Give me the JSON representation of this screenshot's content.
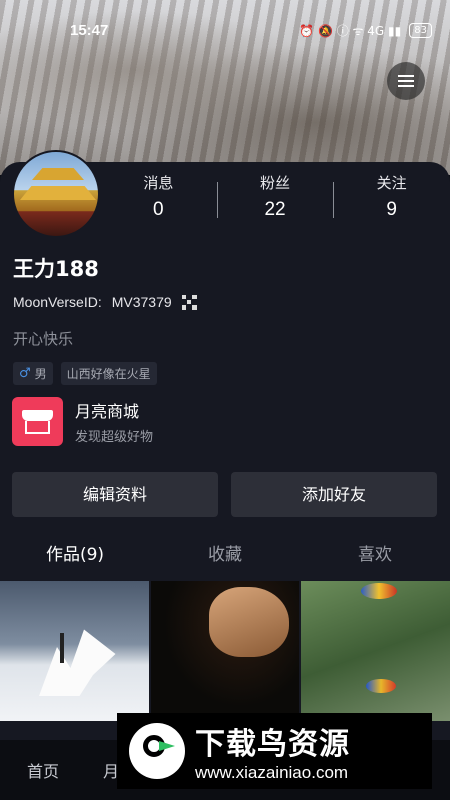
{
  "statusbar": {
    "time": "15:47",
    "indicators": "⏰ 🔕 ⓘ ᯤ 4G ▮▮",
    "battery": "83"
  },
  "profile": {
    "stats": [
      {
        "label": "消息",
        "value": "0"
      },
      {
        "label": "粉丝",
        "value": "22"
      },
      {
        "label": "关注",
        "value": "9"
      }
    ],
    "name": "王力188",
    "id_label": "MoonVerseID:",
    "id_value": "MV37379",
    "bio": "开心快乐",
    "gender_symbol": "♂",
    "gender": "男",
    "location": "山西好像在火星"
  },
  "shop": {
    "title": "月亮商城",
    "subtitle": "发现超级好物"
  },
  "buttons": {
    "edit": "编辑资料",
    "add_friend": "添加好友"
  },
  "tabs": [
    {
      "label": "作品(9)",
      "active": true
    },
    {
      "label": "收藏",
      "active": false
    },
    {
      "label": "喜欢",
      "active": false
    }
  ],
  "bottom_nav": {
    "home": "首页",
    "second": "月"
  },
  "watermark": {
    "title": "下载鸟资源",
    "url": "www.xiazainiao.com"
  },
  "colors": {
    "card_bg": "#161822",
    "shop_red": "#ef3b5a",
    "button_bg": "#2d2f38"
  }
}
